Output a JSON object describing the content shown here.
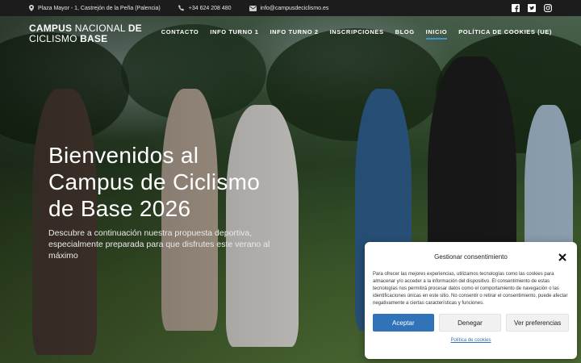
{
  "topbar": {
    "address": "Plaza Mayor - 1, Castrejón de la Peña (Palencia)",
    "phone": "+34 624 208 480",
    "email": "info@campusdeciclismo.es",
    "social": [
      "facebook-icon",
      "twitter-icon",
      "instagram-icon"
    ]
  },
  "logo": {
    "line1_bold": "CAMPUS",
    "line1_thin": "NACIONAL",
    "line1_bold2": "DE",
    "line2_thin": "CICLISMO",
    "line2_bold": "BASE"
  },
  "nav": {
    "items": [
      {
        "label": "CONTACTO"
      },
      {
        "label": "INFO TURNO 1"
      },
      {
        "label": "INFO TURNO 2"
      },
      {
        "label": "INSCRIPCIONES"
      },
      {
        "label": "BLOG"
      },
      {
        "label": "INICIO",
        "active": true
      },
      {
        "label": "POLÍTICA DE COOKIES (UE)"
      }
    ]
  },
  "hero": {
    "title": "Bienvenidos al Campus de Ciclismo de Base 2026",
    "subtitle": "Descubre a continuación nuestra propuesta deportiva, especialmente preparada para que disfrutes este verano al máximo"
  },
  "cookie": {
    "title": "Gestionar consentimiento",
    "text": "Para ofrecer las mejores experiencias, utilizamos tecnologías como las cookies para almacenar y/o acceder a la información del dispositivo. El consentimiento de estas tecnologías nos permitirá procesar datos como el comportamiento de navegación o las identificaciones únicas en este sitio. No consentir o retirar el consentimiento, puede afectar negativamente a ciertas características y funciones.",
    "accept_label": "Aceptar",
    "deny_label": "Denegar",
    "prefs_label": "Ver preferencias",
    "policy_link": "Política de cookies"
  },
  "colors": {
    "accent": "#3173b8",
    "nav_active_underline": "#3c93d6",
    "topbar_bg": "#1c1c1c"
  }
}
